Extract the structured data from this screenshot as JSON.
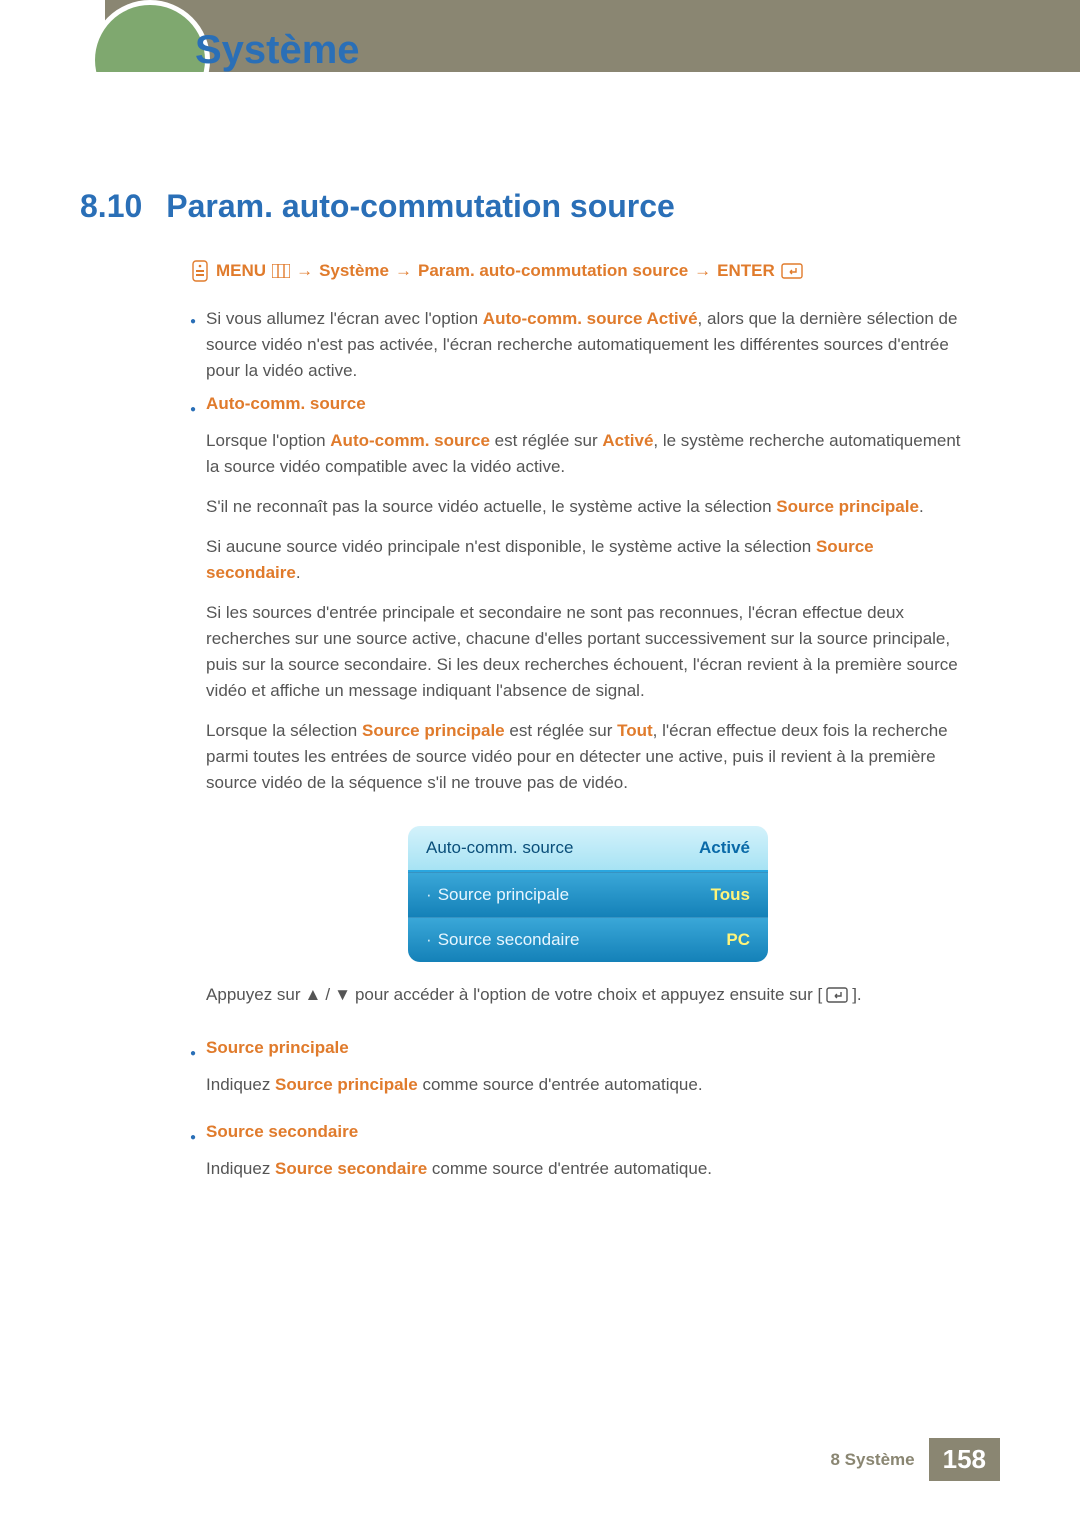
{
  "header": {
    "chapter_title": "Système"
  },
  "section": {
    "number": "8.10",
    "title": "Param. auto-commutation source"
  },
  "breadcrumb": {
    "menu": "MENU",
    "systeme": "Système",
    "param": "Param. auto-commutation source",
    "enter": "ENTER",
    "arrow": "→"
  },
  "intro": {
    "pre": "Si vous allumez l'écran avec l'option ",
    "hl": "Auto-comm. source Activé",
    "post": ", alors que la dernière sélection de source vidéo n'est pas activée, l'écran recherche automatiquement les différentes sources d'entrée pour la vidéo active."
  },
  "auto_comm": {
    "head": "Auto-comm. source",
    "p1_pre": "Lorsque l'option ",
    "p1_hl1": "Auto-comm. source",
    "p1_mid": " est réglée sur ",
    "p1_hl2": "Activé",
    "p1_post": ", le système recherche automatiquement la source vidéo compatible avec la vidéo active.",
    "p2_pre": "S'il ne reconnaît pas la source vidéo actuelle, le système active la sélection ",
    "p2_hl": "Source principale",
    "p2_post": ".",
    "p3_pre": "Si aucune source vidéo principale n'est disponible, le système active la sélection ",
    "p3_hl": "Source secondaire",
    "p3_post": ".",
    "p4": "Si les sources d'entrée principale et secondaire ne sont pas reconnues, l'écran effectue deux recherches sur une source active, chacune d'elles portant successivement sur la source principale, puis sur la source secondaire. Si les deux recherches échouent, l'écran revient à la première source vidéo et affiche un message indiquant l'absence de signal.",
    "p5_pre": "Lorsque la sélection ",
    "p5_hl1": "Source principale",
    "p5_mid": " est réglée sur ",
    "p5_hl2": "Tout",
    "p5_post": ", l'écran effectue deux fois la recherche parmi toutes les entrées de source vidéo pour en détecter une active, puis il revient à la première source vidéo de la séquence s'il ne trouve pas de vidéo."
  },
  "osd": {
    "r1": {
      "label": "Auto-comm. source",
      "value": "Activé"
    },
    "r2": {
      "label": "Source principale",
      "value": "Tous",
      "prefix": "·"
    },
    "r3": {
      "label": "Source secondaire",
      "value": "PC",
      "prefix": "·"
    }
  },
  "nav": {
    "pre": "Appuyez sur ",
    "up": "▲",
    "slash": "/",
    "down": "▼",
    "mid": " pour accéder à l'option de votre choix et appuyez ensuite sur [",
    "post": "]."
  },
  "src_princ": {
    "head": "Source principale",
    "pre": "Indiquez ",
    "hl": "Source principale",
    "post": " comme source d'entrée automatique."
  },
  "src_sec": {
    "head": "Source secondaire",
    "pre": "Indiquez ",
    "hl": "Source secondaire",
    "post": " comme source d'entrée automatique."
  },
  "footer": {
    "label": "8 Système",
    "page": "158"
  }
}
